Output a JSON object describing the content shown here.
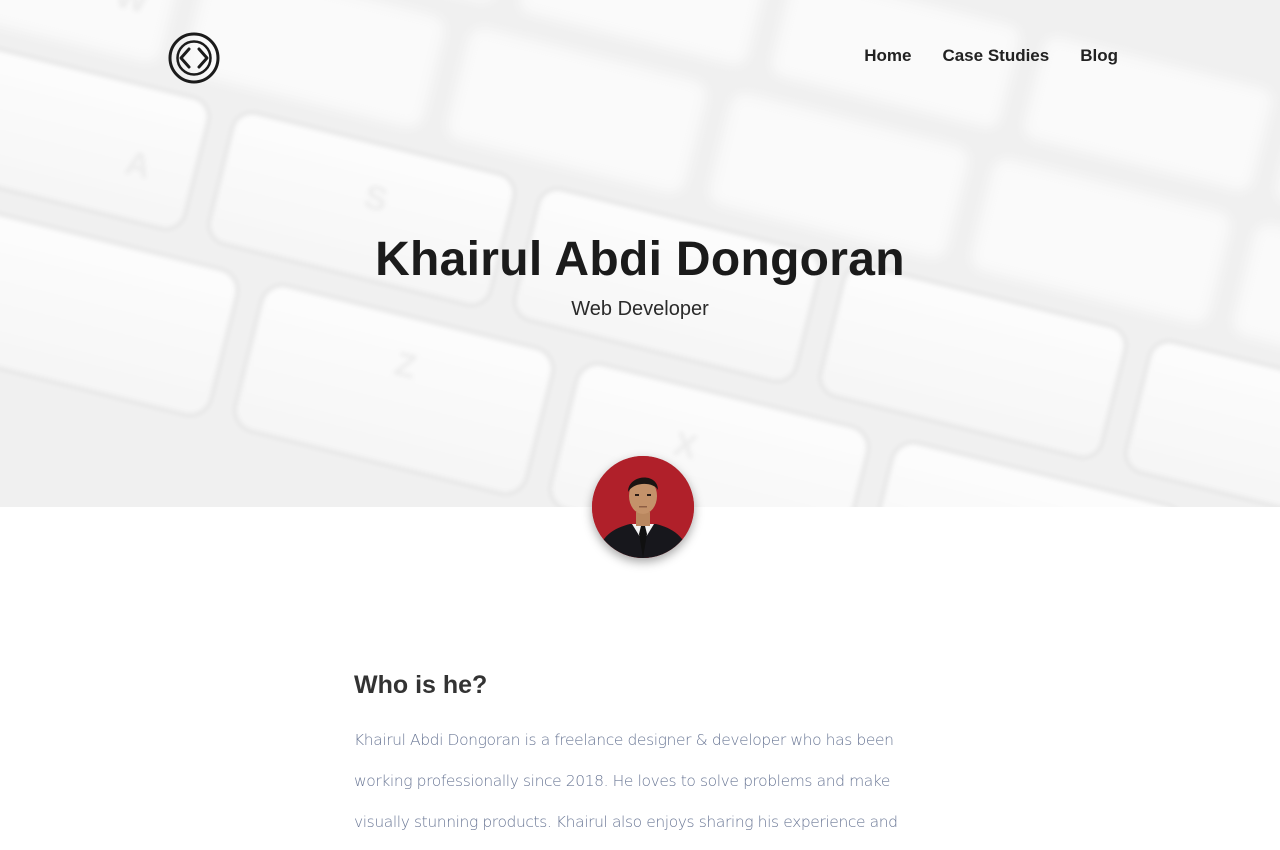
{
  "header": {
    "logo_icon": "code-brackets-icon",
    "nav": [
      {
        "label": "Home"
      },
      {
        "label": "Case Studies"
      },
      {
        "label": "Blog"
      }
    ]
  },
  "hero": {
    "background": "keyboard-photo",
    "title": "Khairul Abdi Dongoran",
    "subtitle": "Web Developer"
  },
  "profile": {
    "avatar": "profile-photo"
  },
  "about": {
    "heading": "Who is he?",
    "text": "Khairul Abdi Dongoran is a freelance designer & developer who has been working professionally since 2018. He loves to solve problems and make visually stunning products. Khairul also enjoys sharing his experience and"
  },
  "colors": {
    "text_dark": "#1b1b1b",
    "body_text": "#6b7896",
    "avatar_bg": "#b0202a"
  }
}
